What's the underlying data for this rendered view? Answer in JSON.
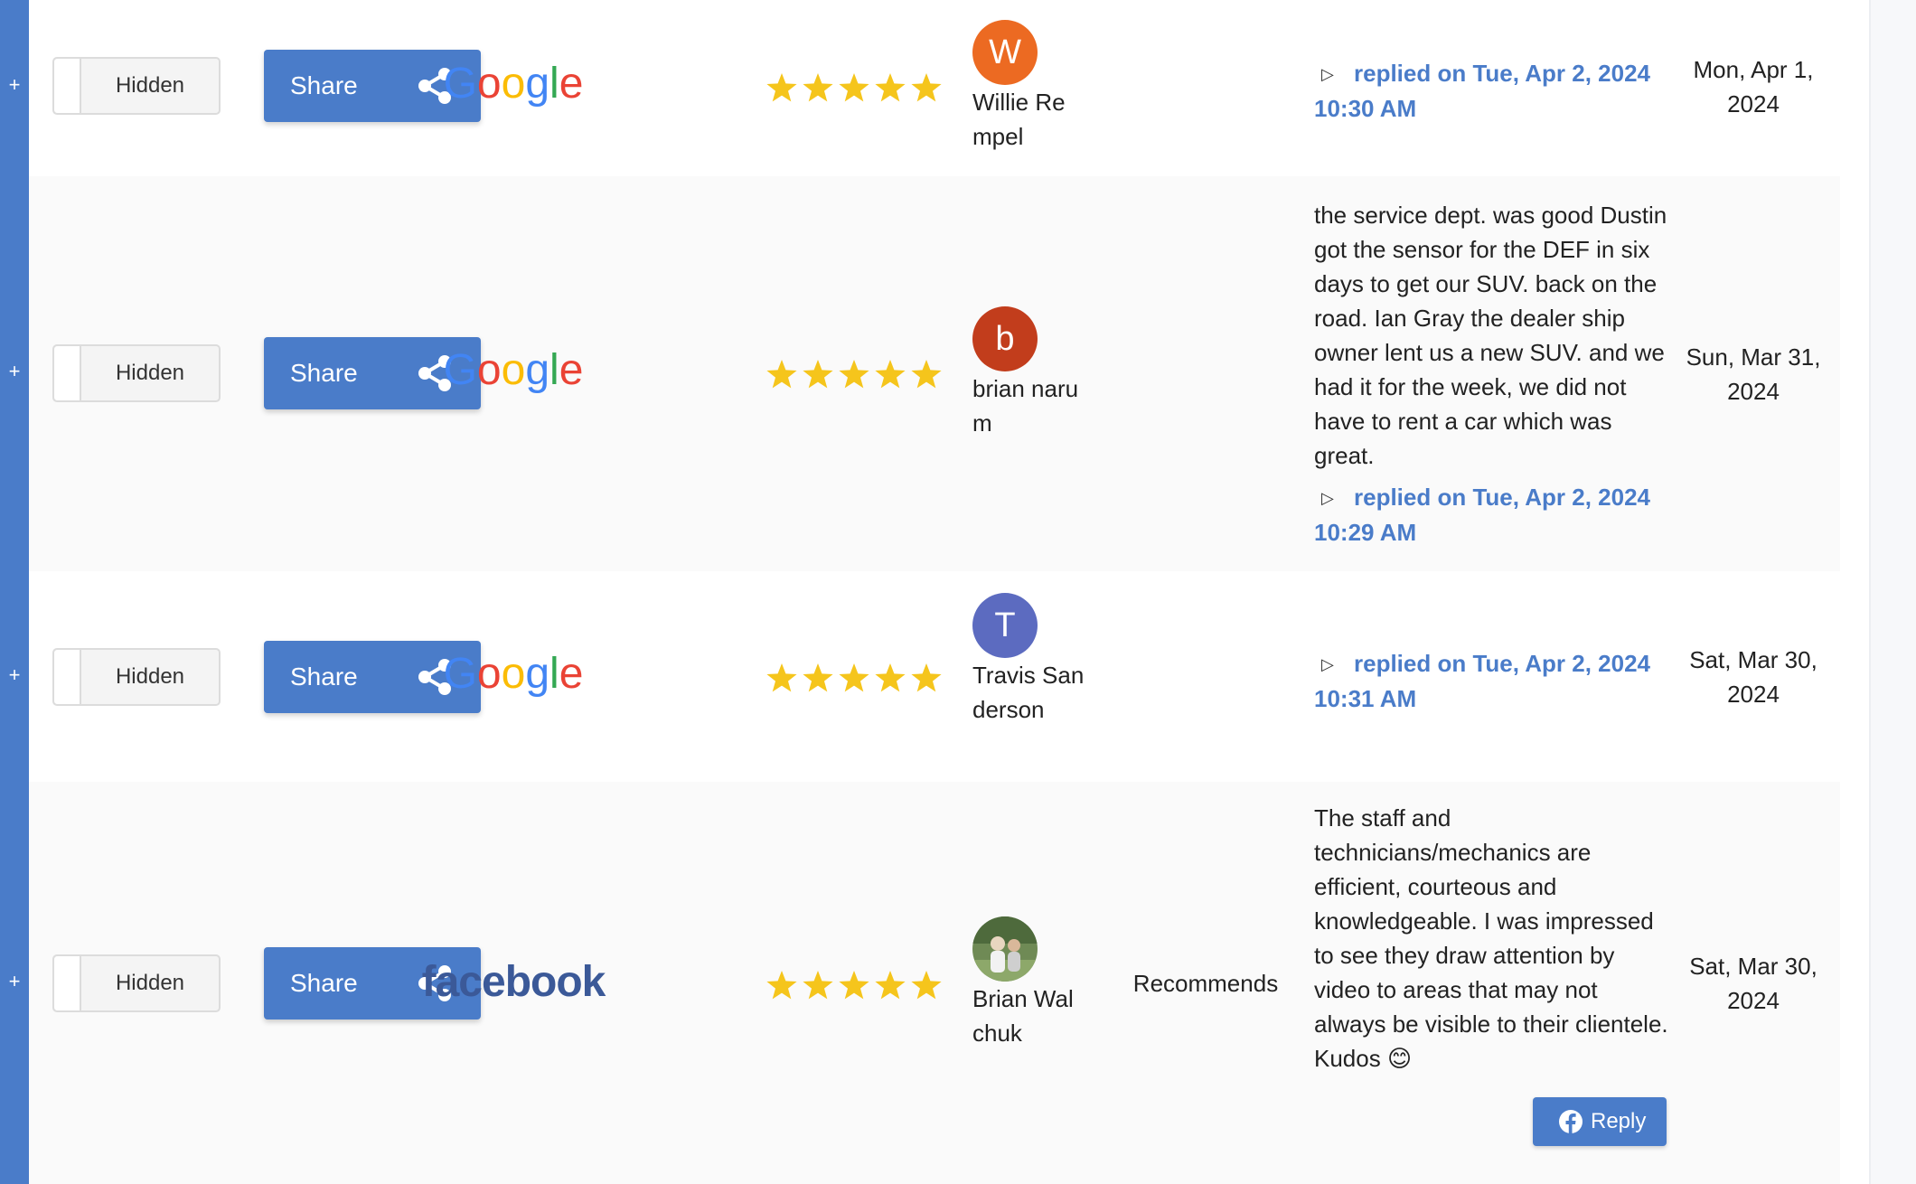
{
  "colors": {
    "accent": "#4a7cc9",
    "star": "#f5c51c",
    "avatar_w": "#ec6a22",
    "avatar_b": "#c23d1c",
    "avatar_t": "#5c6bc0"
  },
  "expand_symbol": "+",
  "toggle_label": "Hidden",
  "share_label": "Share",
  "reviews": [
    {
      "source": "Google",
      "rating": 5,
      "avatar_letter": "W",
      "reviewer": "Willie Rempel",
      "recommend": "",
      "text": "",
      "reply_status": "replied on Tue, Apr 2, 2024 10:30 AM",
      "date": "Mon, Apr 1, 2024"
    },
    {
      "source": "Google",
      "rating": 5,
      "avatar_letter": "b",
      "reviewer": "brian narum",
      "recommend": "",
      "text": "the service dept. was good Dustin got the sensor for the DEF in six days to get our SUV. back on the road. Ian Gray the dealer ship owner lent us a new SUV. and we had it for the week, we did not have to rent a car which was great.",
      "reply_status": "replied on Tue, Apr 2, 2024 10:29 AM",
      "date": "Sun, Mar 31, 2024"
    },
    {
      "source": "Google",
      "rating": 5,
      "avatar_letter": "T",
      "reviewer": "Travis Sanderson",
      "recommend": "",
      "text": "",
      "reply_status": "replied on Tue, Apr 2, 2024 10:31 AM",
      "date": "Sat, Mar 30, 2024"
    },
    {
      "source": "facebook",
      "rating": 5,
      "avatar_letter": "",
      "reviewer": "Brian Walchuk",
      "recommend": "Recommends",
      "text": "The staff and technicians/mechanics are efficient, courteous and knowledgeable. I was impressed to see they draw attention by video to areas that may not always be visible to their clientele. Kudos 😊",
      "reply_status": "",
      "reply_button": "Reply",
      "date": "Sat, Mar 30, 2024"
    }
  ]
}
